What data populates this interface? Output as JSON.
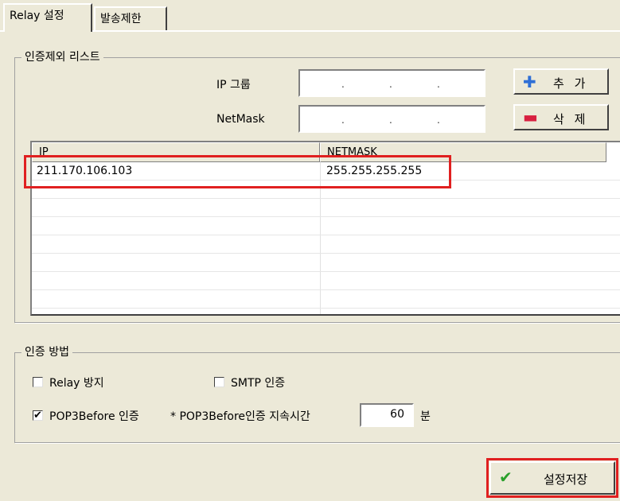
{
  "tabs": [
    {
      "label": "Relay 설정",
      "active": true
    },
    {
      "label": "발송제한",
      "active": false
    }
  ],
  "exclusion_list": {
    "legend": "인증제외 리스트",
    "ip_group_label": "IP 그룹",
    "netmask_label": "NetMask",
    "add_button": "추 가",
    "delete_button": "삭 제",
    "add_icon": "plus-icon",
    "delete_icon": "minus-icon",
    "columns": [
      "IP",
      "NETMASK"
    ],
    "rows": [
      {
        "ip": "211.170.106.103",
        "netmask": "255.255.255.255"
      }
    ]
  },
  "auth_method": {
    "legend": "인증 방법",
    "relay_block": {
      "label": "Relay 방지",
      "checked": false
    },
    "smtp_auth": {
      "label": "SMTP 인증",
      "checked": false
    },
    "pop3_before": {
      "label": "POP3Before 인증",
      "checked": true
    },
    "duration_label": "* POP3Before인증 지속시간",
    "duration_value": "60",
    "duration_unit": "분"
  },
  "save_button": "설정저장",
  "colors": {
    "highlight": "#e02020",
    "dialog_bg": "#ece9d8",
    "save_icon": "#2aa02a"
  }
}
